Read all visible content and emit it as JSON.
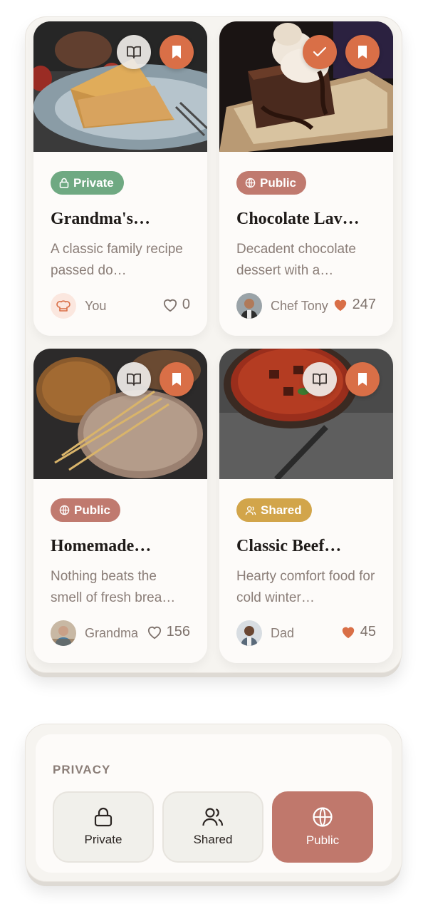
{
  "colors": {
    "accent": "#d96f47",
    "private": "#6fa982",
    "public": "#c07a6f",
    "shared": "#d2a54a",
    "selected_option": "#c0786c"
  },
  "recipes": [
    {
      "title": "Grandma's…",
      "description": "A classic family recipe passed do…",
      "visibility": "Private",
      "visibility_icon": "lock-icon",
      "author": "You",
      "likes": "0",
      "liked": false,
      "status_action": "book-icon"
    },
    {
      "title": "Chocolate Lav…",
      "description": "Decadent chocolate dessert with a…",
      "visibility": "Public",
      "visibility_icon": "globe-icon",
      "author": "Chef Tony",
      "likes": "247",
      "liked": true,
      "status_action": "check-icon"
    },
    {
      "title": "Homemade…",
      "description": "Nothing beats the smell of fresh brea…",
      "visibility": "Public",
      "visibility_icon": "globe-icon",
      "author": "Grandma",
      "likes": "156",
      "liked": false,
      "status_action": "book-icon"
    },
    {
      "title": "Classic Beef…",
      "description": "Hearty comfort food for cold winter…",
      "visibility": "Shared",
      "visibility_icon": "users-icon",
      "author": "Dad",
      "likes": "45",
      "liked": true,
      "status_action": "book-icon"
    }
  ],
  "privacy": {
    "label": "PRIVACY",
    "selected": "Public",
    "options": [
      {
        "label": "Private",
        "icon": "lock-icon"
      },
      {
        "label": "Shared",
        "icon": "users-icon"
      },
      {
        "label": "Public",
        "icon": "globe-icon"
      }
    ]
  }
}
